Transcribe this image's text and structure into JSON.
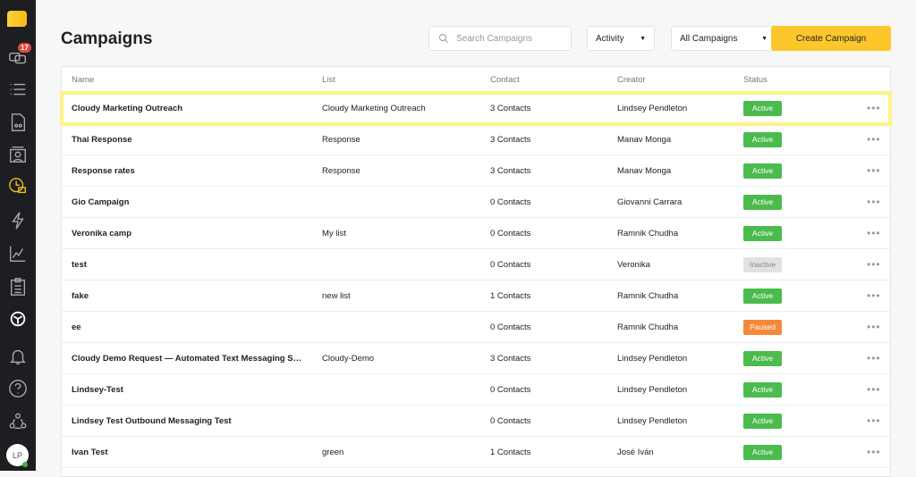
{
  "sidebar": {
    "items": [
      "logo",
      "conversations",
      "lists",
      "templates",
      "contacts",
      "campaigns",
      "automations",
      "analytics",
      "tasks",
      "integrations",
      "notifications",
      "help",
      "team"
    ],
    "badge": "17",
    "avatar": "LP"
  },
  "header": {
    "title": "Campaigns",
    "search_placeholder": "Search Campaigns",
    "activity": "Activity",
    "filter": "All Campaigns",
    "create": "Create Campaign"
  },
  "colors": {
    "accent": "#fdc72b",
    "active": "#4cbb4e",
    "inactive": "#e2e2e2",
    "paused": "#f5893a"
  },
  "table": {
    "headers": [
      "Name",
      "List",
      "Contact",
      "Creator",
      "Status"
    ],
    "rows": [
      {
        "name": "Cloudy Marketing Outreach",
        "list": "Cloudy Marketing Outreach",
        "contact": "3 Contacts",
        "creator": "Lindsey Pendleton",
        "status": "Active"
      },
      {
        "name": "Thai Response",
        "list": "Response",
        "contact": "3 Contacts",
        "creator": "Manav Monga",
        "status": "Active"
      },
      {
        "name": "Response rates",
        "list": "Response",
        "contact": "3 Contacts",
        "creator": "Manav Monga",
        "status": "Active"
      },
      {
        "name": "Gio Campaign",
        "list": "",
        "contact": "0 Contacts",
        "creator": "Giovanni Carrara",
        "status": "Active"
      },
      {
        "name": "Veronika camp",
        "list": "My list",
        "contact": "0 Contacts",
        "creator": "Ramnik Chudha",
        "status": "Active"
      },
      {
        "name": "test",
        "list": "",
        "contact": "0 Contacts",
        "creator": "Veronika",
        "status": "Inactive"
      },
      {
        "name": "fake",
        "list": "new list",
        "contact": "1 Contacts",
        "creator": "Ramnik Chudha",
        "status": "Active"
      },
      {
        "name": "ee",
        "list": "",
        "contact": "0 Contacts",
        "creator": "Ramnik Chudha",
        "status": "Paused"
      },
      {
        "name": "Cloudy Demo Request — Automated Text Messaging Sales",
        "list": "Cloudy-Demo",
        "contact": "3 Contacts",
        "creator": "Lindsey Pendleton",
        "status": "Active"
      },
      {
        "name": "Lindsey-Test",
        "list": "",
        "contact": "0 Contacts",
        "creator": "Lindsey Pendleton",
        "status": "Active"
      },
      {
        "name": "Lindsey Test Outbound Messaging Test",
        "list": "",
        "contact": "0 Contacts",
        "creator": "Lindsey Pendleton",
        "status": "Active"
      },
      {
        "name": "Ivan Test",
        "list": "green",
        "contact": "1 Contacts",
        "creator": "José Iván",
        "status": "Active"
      }
    ]
  }
}
